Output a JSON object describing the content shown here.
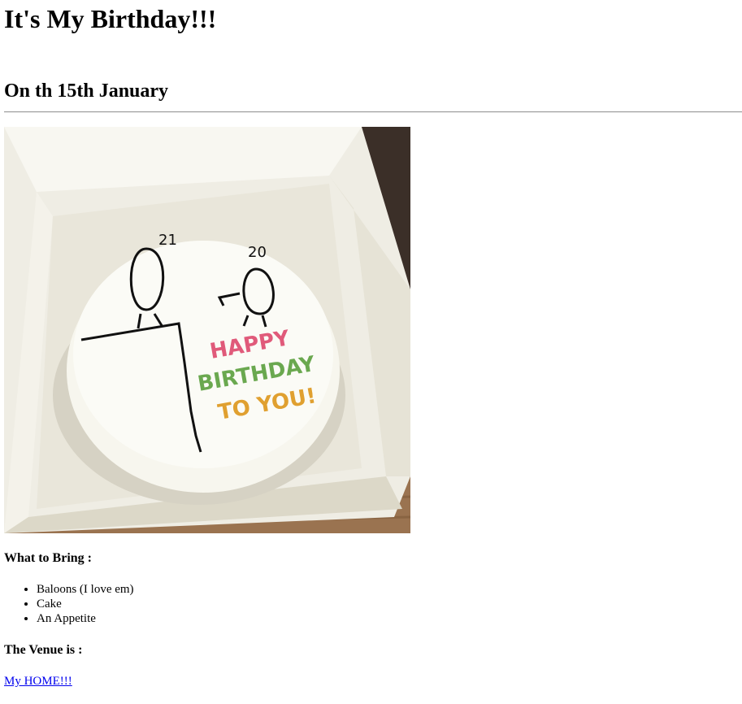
{
  "header": {
    "title": "It's My Birthday!!!",
    "date_line": "On th 15th January"
  },
  "cake_image": {
    "icon": "birthday-cake-photo",
    "cake_text": [
      "HAPPY",
      "BIRTHDAY",
      "TO YOU!"
    ],
    "figure_ages": [
      "21",
      "20"
    ]
  },
  "bring": {
    "heading": "What to Bring :",
    "items": [
      "Baloons (I love em)",
      "Cake",
      "An Appetite"
    ]
  },
  "venue": {
    "heading": "The Venue is :",
    "link_text": "My HOME!!!"
  },
  "colors": {
    "link": "#0000ee",
    "box": "#f3f1e8",
    "table_wood": "#9a7350"
  }
}
